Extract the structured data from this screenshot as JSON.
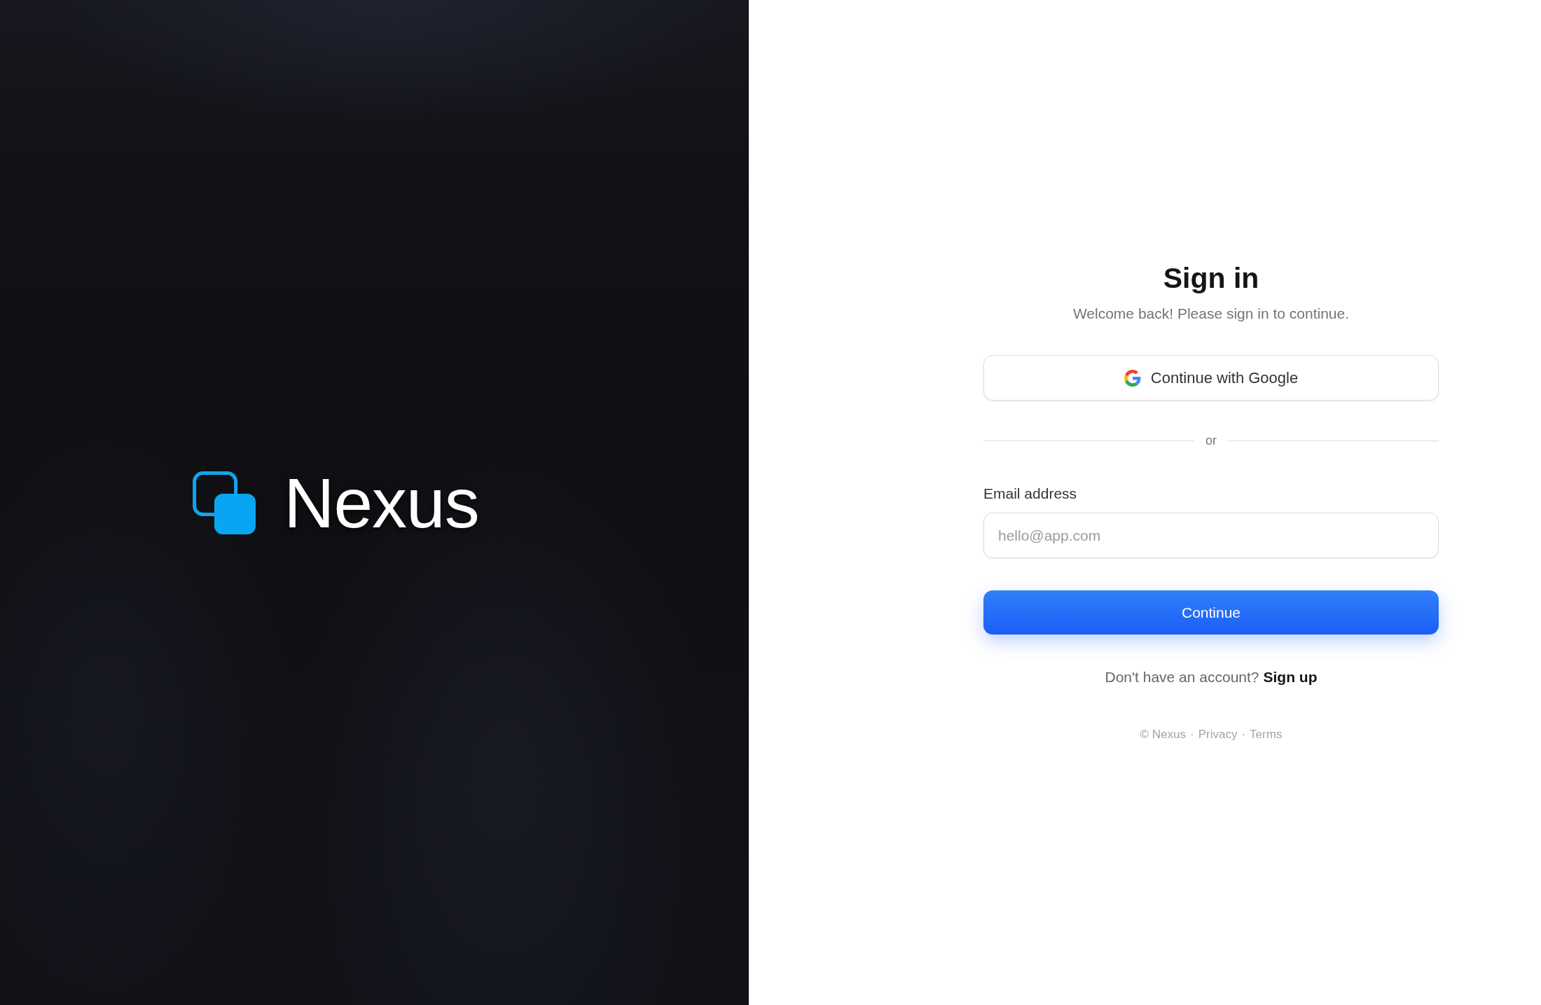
{
  "brand": {
    "name": "Nexus"
  },
  "signin": {
    "title": "Sign in",
    "subtitle": "Welcome back! Please sign in to continue.",
    "oauth_button": {
      "label": "Continue with Google"
    },
    "divider": "or",
    "email": {
      "label": "Email address",
      "placeholder": "hello@app.com"
    },
    "submit_button": {
      "label": "Continue"
    },
    "signup": {
      "prompt": "Don't have an account?",
      "link": "Sign up"
    }
  },
  "footer": {
    "copyright": "© Nexus",
    "links": [
      {
        "separator": "·",
        "label": "Privacy"
      },
      {
        "separator": "·",
        "label": "Terms"
      }
    ]
  }
}
